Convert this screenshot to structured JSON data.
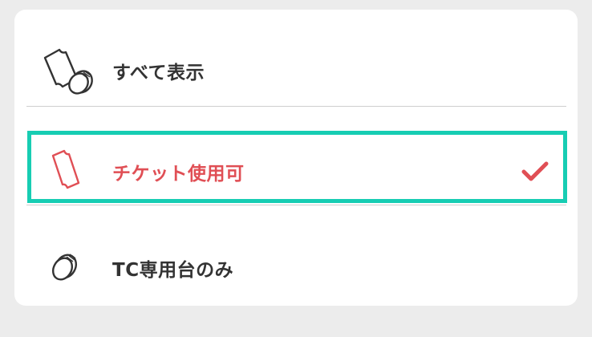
{
  "filter_options": [
    {
      "label": "すべて表示",
      "icon": "ticket-coin-icon",
      "selected": false
    },
    {
      "label": "チケット使用可",
      "icon": "ticket-icon",
      "selected": true
    },
    {
      "label": "TC専用台のみ",
      "icon": "coin-icon",
      "selected": false
    }
  ],
  "colors": {
    "active_text": "#e04f55",
    "highlight_border": "#17cdb3",
    "default_text": "#333333",
    "check": "#e04f55"
  },
  "checkmark_icon": "checkmark-icon"
}
